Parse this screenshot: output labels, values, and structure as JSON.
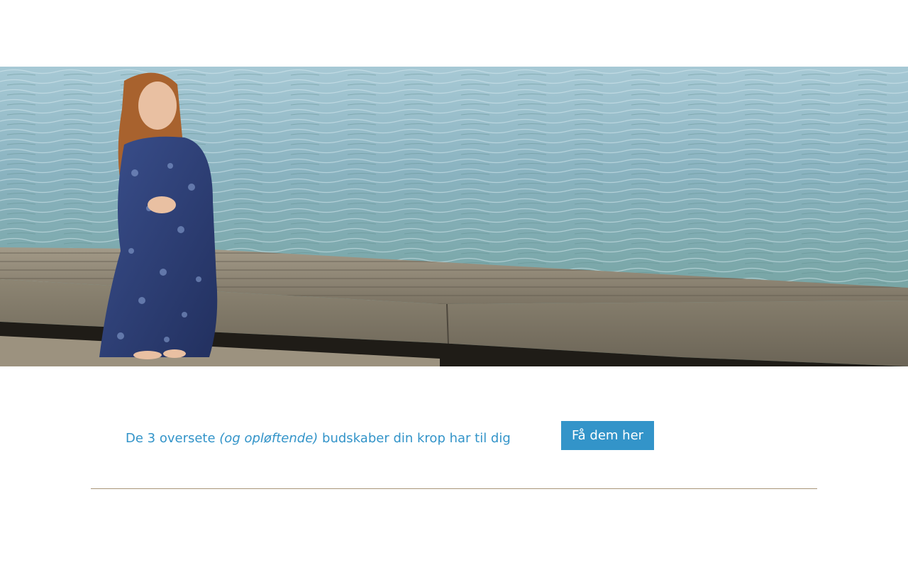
{
  "hero": {
    "image": "woman-sitting-on-wooden-pier-by-water",
    "colors": {
      "water": "#8fb6c4",
      "pier": "#8a8170",
      "dress": "#2c3f78"
    }
  },
  "cta": {
    "text_before": "De 3 oversete ",
    "text_italic": "(og opløftende)",
    "text_after": " budskaber din krop har til dig",
    "button_label": "Få dem her",
    "accent_color": "#3394c9"
  },
  "divider": {
    "color": "#a89478"
  }
}
